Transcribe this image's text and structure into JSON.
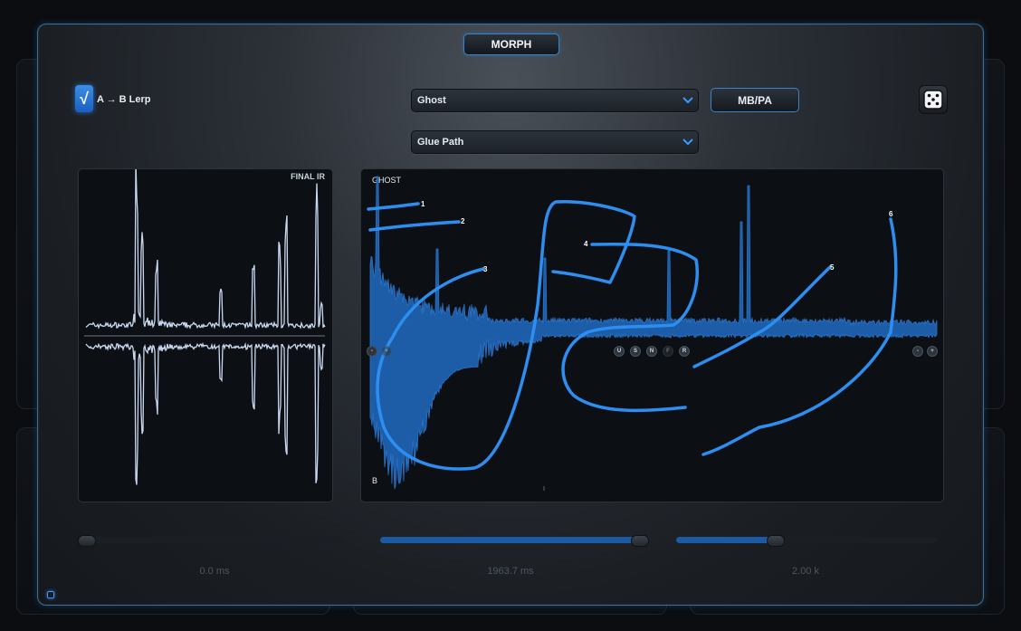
{
  "header": {
    "title": "MORPH"
  },
  "lerp": {
    "label": "A → B Lerp",
    "checked": true,
    "check_glyph": "√"
  },
  "dropdowns": {
    "source": {
      "value": "Ghost"
    },
    "path": {
      "value": "Glue Path"
    }
  },
  "mbpa_button": {
    "label": "MB/PA"
  },
  "dice": {
    "icon": "dice-icon"
  },
  "final_ir": {
    "label": "FINAL IR"
  },
  "ghost_panel": {
    "top_label": "GHOST",
    "bottom_label": "B",
    "path_labels": [
      "1",
      "2",
      "3",
      "4",
      "5",
      "6"
    ],
    "left_buttons": [
      "-",
      "+"
    ],
    "mode_buttons": [
      "U",
      "S",
      "N",
      "F",
      "R"
    ],
    "right_buttons": [
      "-",
      "+"
    ]
  },
  "sliders": [
    {
      "fraction": 0.0,
      "value_text": "0.0 ms"
    },
    {
      "fraction": 0.97,
      "value_text": "1963.7 ms"
    },
    {
      "fraction": 0.38,
      "value_text": "2.00 k"
    }
  ],
  "colors": {
    "accent": "#2f8fff",
    "stroke": "#2d8ef0",
    "waveform_fill": "#1d5da8",
    "ir_line": "#c9d8ee"
  }
}
